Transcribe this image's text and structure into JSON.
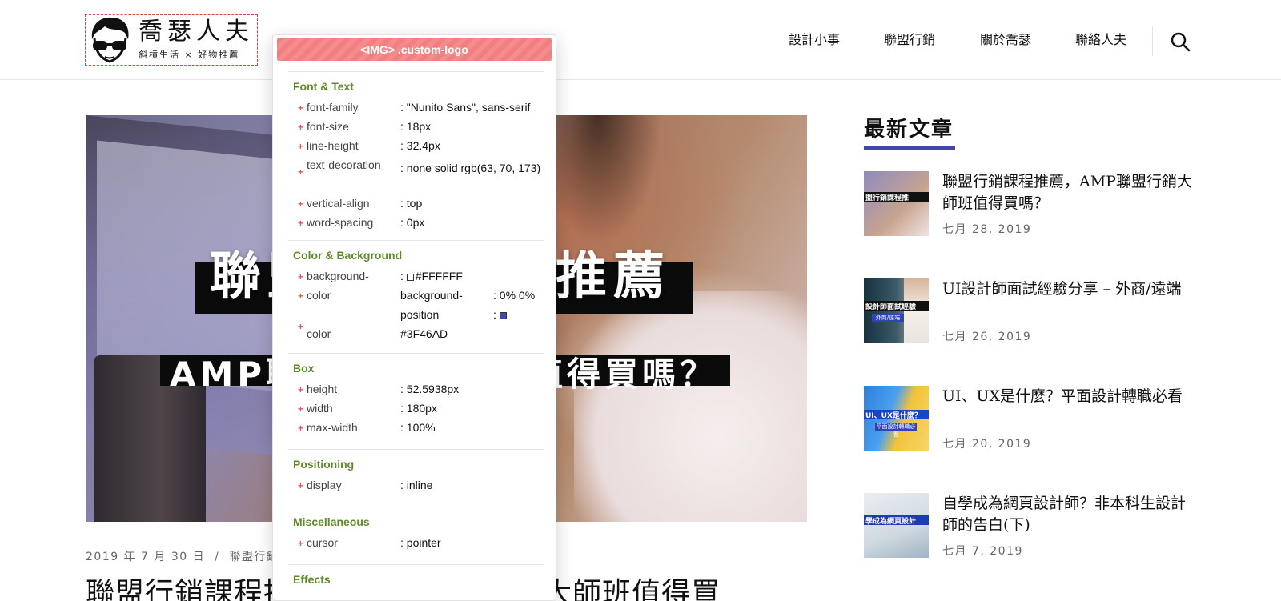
{
  "header": {
    "logo": {
      "title": "喬瑟人夫",
      "tagline": "斜槓生活 × 好物推薦"
    },
    "nav": [
      "設計小事",
      "聯盟行銷",
      "關於喬瑟",
      "聯絡人夫"
    ],
    "search_icon": "search-icon"
  },
  "hero": {
    "line1": "聯盟行銷課程推薦",
    "line2": "AMP聯盟行銷大師班值得買嗎？"
  },
  "post": {
    "date": "2019 年 7 月 30 日",
    "separator": "/",
    "category": "聯盟行銷",
    "title": "聯盟行銷課程推薦，AMP聯盟行銷大師班值得買"
  },
  "sidebar": {
    "heading": "最新文章",
    "accent_color": "#3F46AD",
    "items": [
      {
        "title": "聯盟行銷課程推薦，AMP聯盟行銷大師班值得買嗎？",
        "date": "七月 28, 2019",
        "thumb_text": "盟行銷課程推",
        "thumb_sub": ""
      },
      {
        "title": "UI設計師面試經驗分享 – 外商/遠端",
        "date": "七月 26, 2019",
        "thumb_text": "設計師面試經驗",
        "thumb_sub": "外商/遠端"
      },
      {
        "title": "UI、UX是什麼？平面設計轉職必看",
        "date": "七月 20, 2019",
        "thumb_text": "UI、UX是什麼？",
        "thumb_sub": "平面設計轉職必看"
      },
      {
        "title": "自學成為網頁設計師？非本科生設計師的告白(下)",
        "date": "七月 7, 2019",
        "thumb_text": "學成為網頁設計",
        "thumb_sub": ""
      }
    ]
  },
  "inspector": {
    "header": "<IMG> .custom-logo",
    "sections": {
      "font_text": {
        "title": "Font & Text",
        "rows": [
          {
            "prop": "font-family",
            "val": ": \"Nunito Sans\", sans-serif"
          },
          {
            "prop": "font-size",
            "val": ": 18px"
          },
          {
            "prop": "line-height",
            "val": ": 32.4px"
          },
          {
            "prop": "text-decoration",
            "val": ": none solid rgb(63, 70, 173)"
          },
          {
            "prop": "vertical-align",
            "val": ": top"
          },
          {
            "prop": "word-spacing",
            "val": ": 0px"
          }
        ]
      },
      "color_bg": {
        "title": "Color & Background",
        "background_prop": "background-",
        "background_val": "#FFFFFF",
        "color_prop": "color",
        "bgpos_prop": "background-",
        "bgpos_prop2": "position",
        "bgpos_val": ": 0% 0%",
        "colon": ":",
        "color2_prop": "color",
        "color2_val": "#3F46AD",
        "swatch_white": "#FFFFFF",
        "swatch_blue": "#3F46AD"
      },
      "box": {
        "title": "Box",
        "rows": [
          {
            "prop": "height",
            "val": ": 52.5938px"
          },
          {
            "prop": "width",
            "val": ": 180px"
          },
          {
            "prop": "max-width",
            "val": ": 100%"
          }
        ]
      },
      "positioning": {
        "title": "Positioning",
        "rows": [
          {
            "prop": "display",
            "val": ": inline"
          }
        ]
      },
      "misc": {
        "title": "Miscellaneous",
        "rows": [
          {
            "prop": "cursor",
            "val": ": pointer"
          }
        ]
      },
      "effects": {
        "title": "Effects"
      }
    }
  }
}
